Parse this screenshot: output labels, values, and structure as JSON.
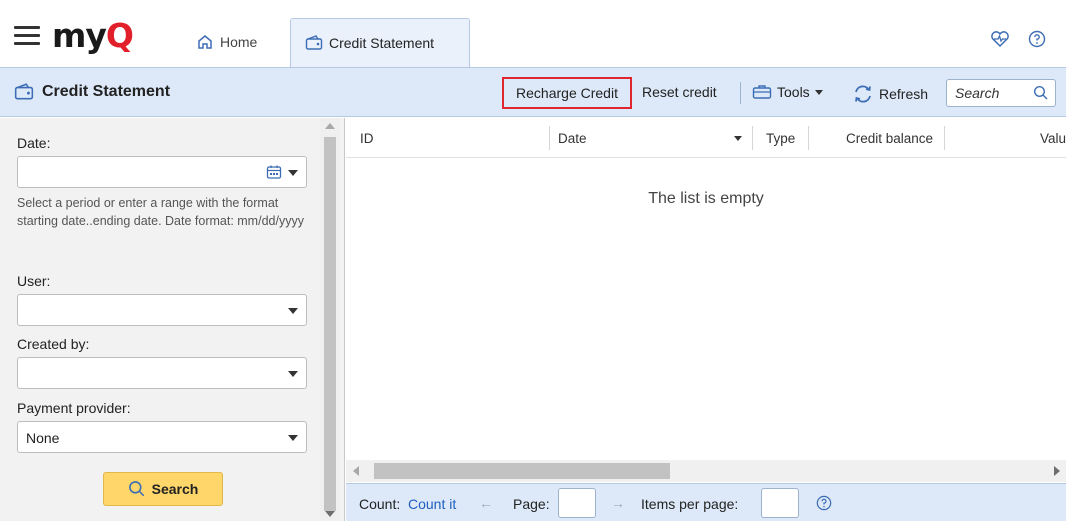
{
  "app": {
    "logo_main": "my",
    "logo_accent": "Q"
  },
  "tabs": [
    {
      "label": "Home",
      "icon": "home-icon"
    },
    {
      "label": "Credit Statement",
      "icon": "wallet-icon"
    }
  ],
  "toolbar": {
    "title": "Credit Statement",
    "recharge_label": "Recharge Credit",
    "reset_label": "Reset credit",
    "tools_label": "Tools",
    "refresh_label": "Refresh",
    "search_placeholder": "Search"
  },
  "filters": {
    "date_label": "Date:",
    "date_value": "",
    "date_hint": "Select a period or enter a range with the format starting date..ending date. Date format: mm/dd/yyyy",
    "user_label": "User:",
    "user_value": "",
    "created_by_label": "Created by:",
    "created_by_value": "",
    "payment_provider_label": "Payment provider:",
    "payment_provider_value": "None",
    "search_button": "Search"
  },
  "grid": {
    "columns": [
      "ID",
      "Date",
      "Type",
      "Credit balance",
      "Valu"
    ],
    "empty_message": "The list is empty"
  },
  "footer": {
    "count_label": "Count:",
    "count_link": "Count it",
    "page_label": "Page:",
    "page_value": "",
    "items_label": "Items per page:",
    "items_value": ""
  },
  "colors": {
    "accent_red": "#e2202b",
    "toolbar_bg": "#dde9f8",
    "search_btn": "#ffd66a",
    "link": "#1f5fbf"
  }
}
